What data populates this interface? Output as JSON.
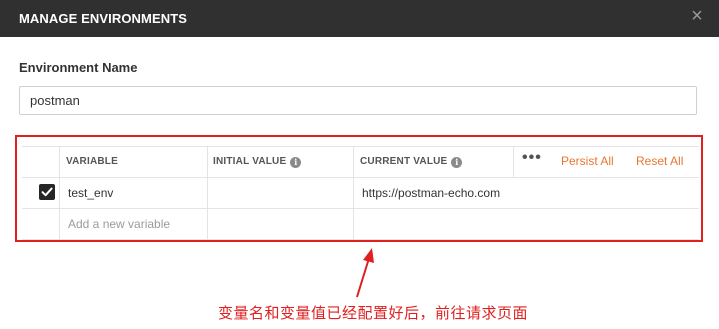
{
  "dialog": {
    "title": "MANAGE ENVIRONMENTS",
    "close_glyph": "×"
  },
  "environment": {
    "label": "Environment Name",
    "name_value": "postman"
  },
  "table": {
    "headers": {
      "variable": "VARIABLE",
      "initial_value": "INITIAL VALUE",
      "current_value": "CURRENT VALUE"
    },
    "more_glyph": "•••",
    "persist_all": "Persist All",
    "reset_all": "Reset All",
    "rows": [
      {
        "checked": true,
        "variable": "test_env",
        "initial_value": "",
        "current_value": "https://postman-echo.com"
      }
    ],
    "new_variable_placeholder": "Add a new variable"
  },
  "annotation": {
    "text": "变量名和变量值已经配置好后，前往请求页面",
    "color": "#e02020"
  },
  "colors": {
    "titlebar": "#303030",
    "accent_link": "#e8772e",
    "highlight_red": "#e02020"
  }
}
